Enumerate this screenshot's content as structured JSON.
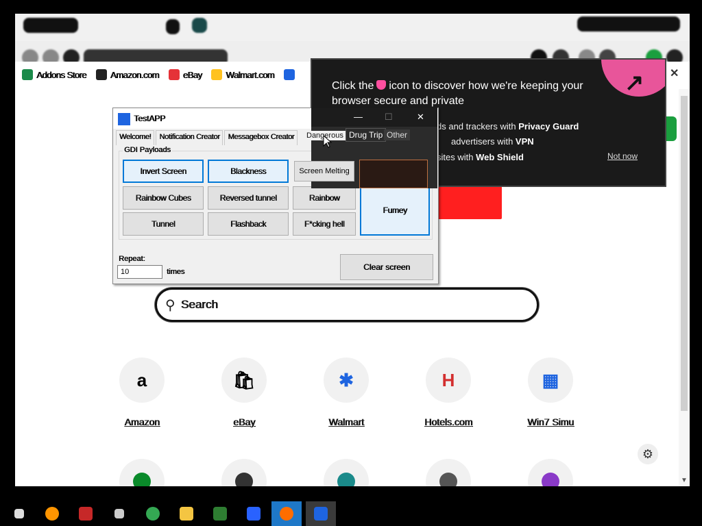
{
  "bookmarks": [
    {
      "label": "Addons Store",
      "color": "#1a8a4a"
    },
    {
      "label": "Amazon.com",
      "color": "#222222"
    },
    {
      "label": "eBay",
      "color": "#e53238"
    },
    {
      "label": "Walmart.com",
      "color": "#ffc220"
    },
    {
      "label": "",
      "color": "#1e64e0"
    }
  ],
  "search": {
    "placeholder": "Search"
  },
  "tiles": [
    {
      "label": "Amazon",
      "glyph": "a"
    },
    {
      "label": "eBay",
      "glyph": "🛍"
    },
    {
      "label": "Walmart",
      "glyph": "✱"
    },
    {
      "label": "Hotels.com",
      "glyph": "H"
    },
    {
      "label": "Win7 Simu",
      "glyph": "▦"
    }
  ],
  "popup": {
    "title_before": "Click the",
    "title_after": "icon to discover how we're keeping your browser secure and private",
    "line1_prefix": "ds and trackers with ",
    "line1_bold": "Privacy Guard",
    "line2_prefix": "advertisers with ",
    "line2_bold": "VPN",
    "line3_prefix": "sites with ",
    "line3_bold": "Web Shield",
    "not_now": "Not now"
  },
  "app": {
    "title": "TestAPP",
    "tabs": [
      "Welcome!",
      "Notification Creator",
      "Messagebox Creator"
    ],
    "group_label": "GDI Payloads",
    "buttons": [
      [
        "Invert Screen",
        "Blackness",
        "",
        "Fumey"
      ],
      [
        "Rainbow Cubes",
        "Reversed tunnel",
        "Rainbow",
        ""
      ],
      [
        "Tunnel",
        "Flashback",
        "F*cking hell",
        ""
      ]
    ],
    "repeat_label": "Repeat:",
    "repeat_value": "10",
    "times_label": "times",
    "clear_label": "Clear screen"
  },
  "overlay": {
    "minimize": "—",
    "maximize": "☐",
    "close": "✕",
    "tab_dangerous": "Dangerous",
    "tab_drug": "Drug Trip",
    "tab_other": "Other",
    "screen_melting": "Screen Melting"
  },
  "taskbar": {
    "items": [
      {
        "name": "taskbar-start",
        "color": "#dddddd"
      },
      {
        "name": "taskbar-firefox",
        "color": "#ff9500"
      },
      {
        "name": "taskbar-toolbox",
        "color": "#c62828"
      },
      {
        "name": "taskbar-app-box",
        "color": "#cccccc"
      },
      {
        "name": "taskbar-chrome",
        "color": "#34a853"
      },
      {
        "name": "taskbar-folder",
        "color": "#f4c542"
      },
      {
        "name": "taskbar-paint",
        "color": "#2e7d32"
      },
      {
        "name": "taskbar-image",
        "color": "#2962ff"
      },
      {
        "name": "taskbar-avast",
        "color": "#ff6d00"
      },
      {
        "name": "taskbar-testapp",
        "color": "#1e64e0"
      }
    ]
  }
}
